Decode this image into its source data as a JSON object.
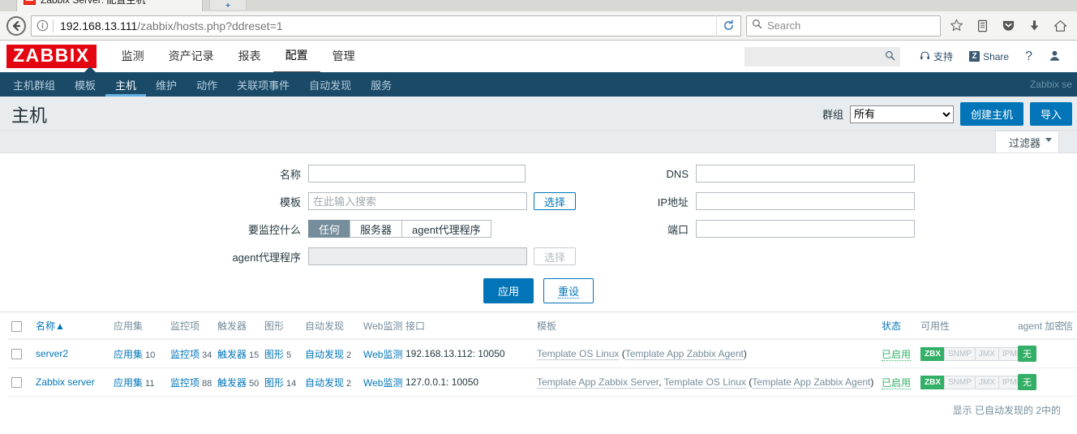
{
  "browser": {
    "tab_title": "Zabbix Server: 配置主机",
    "new_tab_label": "+",
    "url_host": "192.168.13.111",
    "url_path": "/zabbix/hosts.php?ddreset=1",
    "search_placeholder": "Search",
    "icons": {
      "back": "back-arrow-icon",
      "info": "page-info-icon",
      "reload": "reload-icon",
      "search": "search-icon",
      "bookmark": "star-icon",
      "library": "library-icon",
      "pocket": "pocket-icon",
      "downloads": "download-arrow-icon",
      "home": "home-icon"
    }
  },
  "zabbix": {
    "logo": "ZABBIX",
    "topnav": [
      {
        "label": "监测",
        "selected": false
      },
      {
        "label": "资产记录",
        "selected": false
      },
      {
        "label": "报表",
        "selected": false
      },
      {
        "label": "配置",
        "selected": true
      },
      {
        "label": "管理",
        "selected": false
      }
    ],
    "header_search_value": "",
    "support_label": "支持",
    "share_label": "Share",
    "share_badge": "Z",
    "help_label": "?",
    "user_icon": "user-avatar-icon",
    "subnav": [
      {
        "label": "主机群组",
        "selected": false
      },
      {
        "label": "模板",
        "selected": false
      },
      {
        "label": "主机",
        "selected": true
      },
      {
        "label": "维护",
        "selected": false
      },
      {
        "label": "动作",
        "selected": false
      },
      {
        "label": "关联项事件",
        "selected": false
      },
      {
        "label": "自动发现",
        "selected": false
      },
      {
        "label": "服务",
        "selected": false
      }
    ],
    "server_label": "Zabbix se"
  },
  "page": {
    "title": "主机",
    "group_label": "群组",
    "group_value": "所有",
    "group_options": [
      "所有"
    ],
    "create_host_label": "创建主机",
    "import_label": "导入",
    "filter_tab_label": "过滤器"
  },
  "filter": {
    "name_label": "名称",
    "name_value": "",
    "template_label": "模板",
    "template_placeholder": "在此输入搜索",
    "template_value": "",
    "template_select_label": "选择",
    "monitored_by_label": "要监控什么",
    "monitored_by_options": [
      {
        "label": "任何",
        "selected": true
      },
      {
        "label": "服务器",
        "selected": false
      },
      {
        "label": "agent代理程序",
        "selected": false
      }
    ],
    "proxy_label": "agent代理程序",
    "proxy_value": "",
    "proxy_select_label": "选择",
    "dns_label": "DNS",
    "dns_value": "",
    "ip_label": "IP地址",
    "ip_value": "",
    "port_label": "端口",
    "port_value": "",
    "apply_label": "应用",
    "reset_label": "重设"
  },
  "table": {
    "headers": {
      "name": "名称",
      "sort_arrow": "▲",
      "applications": "应用集",
      "items": "监控项",
      "triggers": "触发器",
      "graphs": "图形",
      "discovery": "自动发现",
      "web": "Web监测",
      "interface": "接口",
      "templates": "模板",
      "status": "状态",
      "availability": "可用性",
      "agent_encryption": "agent 加密",
      "info": "信"
    },
    "rows": [
      {
        "name": "server2",
        "applications": {
          "label": "应用集",
          "count": "10"
        },
        "items": {
          "label": "监控项",
          "count": "34"
        },
        "triggers": {
          "label": "触发器",
          "count": "15"
        },
        "graphs": {
          "label": "图形",
          "count": "5"
        },
        "discovery": {
          "label": "自动发现",
          "count": "2"
        },
        "web": {
          "label": "Web监测",
          "count": ""
        },
        "interface": "192.168.13.112: 10050",
        "templates": [
          {
            "text": "Template OS Linux",
            "link": true
          },
          {
            "text": " (",
            "link": false
          },
          {
            "text": "Template App Zabbix Agent",
            "link": true
          },
          {
            "text": ")",
            "link": false
          }
        ],
        "status": "已启用",
        "availability": [
          {
            "label": "ZBX",
            "active": true
          },
          {
            "label": "SNMP",
            "active": false
          },
          {
            "label": "JMX",
            "active": false
          },
          {
            "label": "IPMI",
            "active": false
          }
        ],
        "encryption": "无",
        "info": ""
      },
      {
        "name": "Zabbix server",
        "applications": {
          "label": "应用集",
          "count": "11"
        },
        "items": {
          "label": "监控项",
          "count": "88"
        },
        "triggers": {
          "label": "触发器",
          "count": "50"
        },
        "graphs": {
          "label": "图形",
          "count": "14"
        },
        "discovery": {
          "label": "自动发现",
          "count": "2"
        },
        "web": {
          "label": "Web监测",
          "count": ""
        },
        "interface": "127.0.0.1: 10050",
        "templates": [
          {
            "text": "Template App Zabbix Server",
            "link": true
          },
          {
            "text": ", ",
            "link": false
          },
          {
            "text": "Template OS Linux",
            "link": true
          },
          {
            "text": " (",
            "link": false
          },
          {
            "text": "Template App Zabbix Agent",
            "link": true
          },
          {
            "text": ")",
            "link": false
          }
        ],
        "status": "已启用",
        "availability": [
          {
            "label": "ZBX",
            "active": true
          },
          {
            "label": "SNMP",
            "active": false
          },
          {
            "label": "JMX",
            "active": false
          },
          {
            "label": "IPMI",
            "active": false
          }
        ],
        "encryption": "无",
        "info": ""
      }
    ],
    "footer_text": "显示 已自动发现的 2中的"
  },
  "colors": {
    "brand_red": "#e30611",
    "accent_blue": "#0275b8",
    "subnav_bg": "#1a4a68",
    "status_green": "#34af67",
    "muted": "#768d9c"
  }
}
